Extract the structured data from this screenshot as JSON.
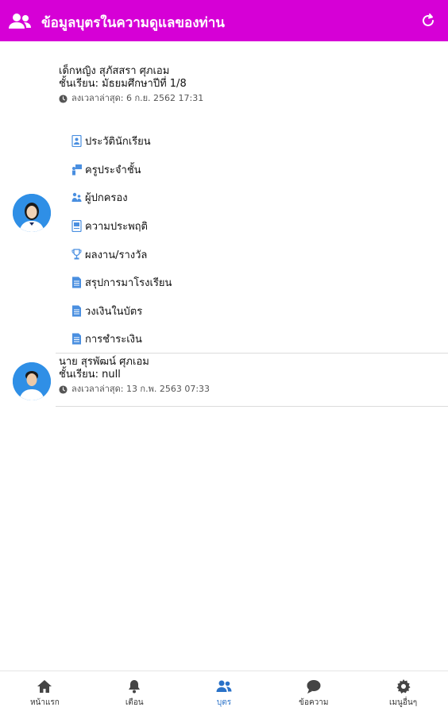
{
  "header": {
    "title": "ข้อมูลบุตรในความดูแลของท่าน",
    "icon": "users-icon",
    "refresh_icon": "refresh-icon",
    "background_color": "#d600d6"
  },
  "children": [
    {
      "name": "เด็กหญิง สุภัสสรา ศุภเอม",
      "class": "ชั้นเรียน: มัธยมศึกษาปีที่ 1/8",
      "last_update": "ลงเวลาล่าสุด: 6 ก.ย. 2562 17:31",
      "menu": [
        {
          "label": "ประวัตินักเรียน",
          "icon": "profile-icon"
        },
        {
          "label": "ครูประจำชั้น",
          "icon": "teacher-icon"
        },
        {
          "label": "ผู้ปกครอง",
          "icon": "parent-icon"
        },
        {
          "label": "ความประพฤติ",
          "icon": "behavior-icon"
        },
        {
          "label": "ผลงาน/รางวัล",
          "icon": "trophy-icon"
        },
        {
          "label": "สรุปการมาโรงเรียน",
          "icon": "document-icon"
        },
        {
          "label": "วงเงินในบัตร",
          "icon": "document-icon"
        },
        {
          "label": "การชำระเงิน",
          "icon": "document-icon"
        }
      ]
    },
    {
      "name": "นาย สุรพัฒน์ ศุภเอม",
      "class": "ชั้นเรียน: null",
      "last_update": "ลงเวลาล่าสุด: 13 ก.พ. 2563 07:33"
    }
  ],
  "bottom_nav": [
    {
      "label": "หน้าแรก",
      "icon": "home-icon",
      "active": false
    },
    {
      "label": "เตือน",
      "icon": "bell-icon",
      "active": false
    },
    {
      "label": "บุตร",
      "icon": "users-icon",
      "active": true
    },
    {
      "label": "ข้อความ",
      "icon": "chat-icon",
      "active": false
    },
    {
      "label": "เมนูอื่นๆ",
      "icon": "gear-icon",
      "active": false
    }
  ],
  "colors": {
    "accent": "#d600d6",
    "nav_active": "#2a72c8",
    "menu_icon": "#4a8fe0"
  }
}
